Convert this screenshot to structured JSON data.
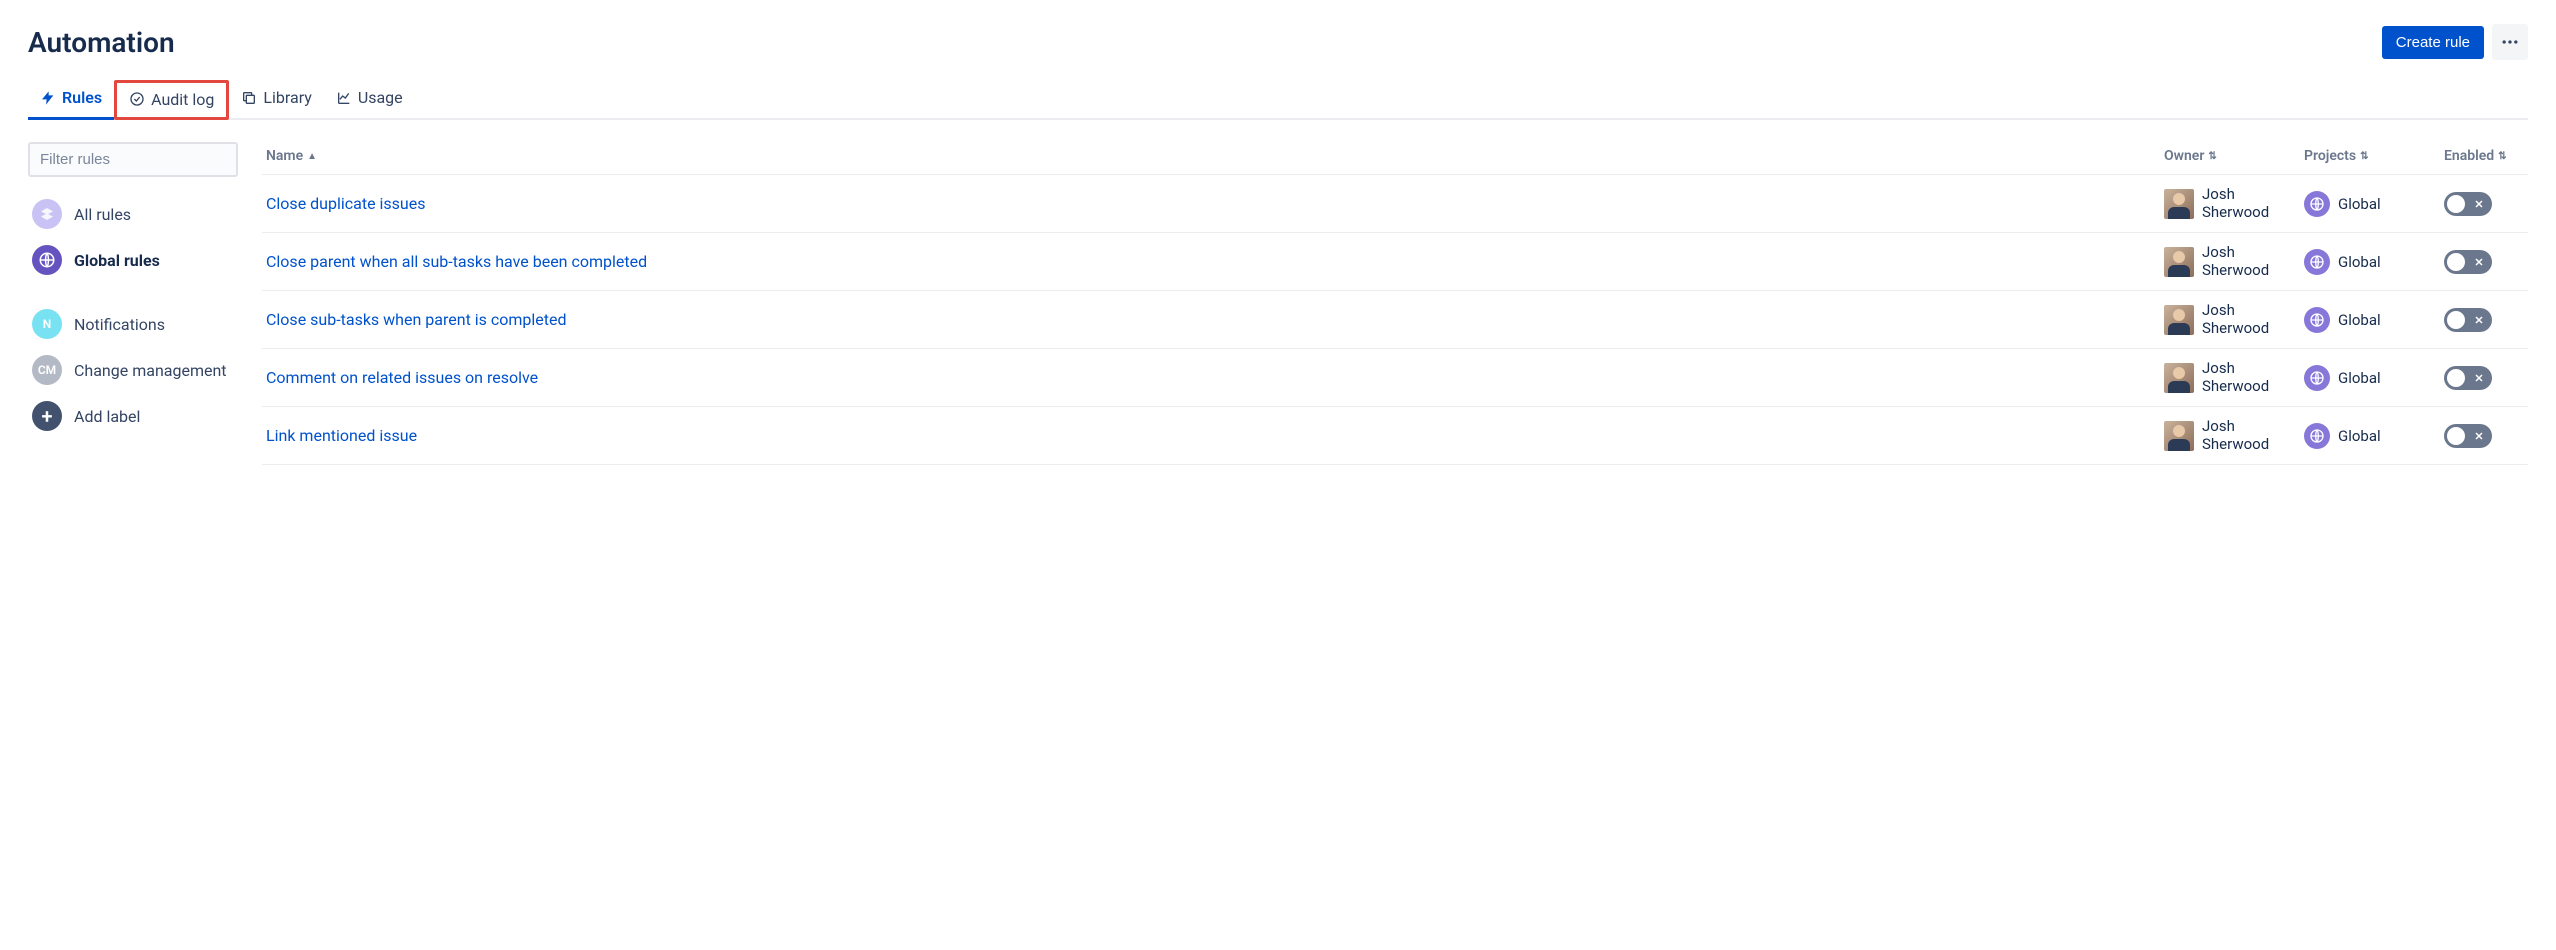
{
  "header": {
    "title": "Automation",
    "create_button": "Create rule"
  },
  "tabs": [
    {
      "id": "rules",
      "label": "Rules",
      "icon": "bolt-icon",
      "active": true
    },
    {
      "id": "auditlog",
      "label": "Audit log",
      "icon": "check-circle-icon",
      "highlighted": true
    },
    {
      "id": "library",
      "label": "Library",
      "icon": "copy-icon"
    },
    {
      "id": "usage",
      "label": "Usage",
      "icon": "chart-icon"
    }
  ],
  "sidebar": {
    "filter_placeholder": "Filter rules",
    "groups": [
      [
        {
          "id": "all",
          "label": "All rules",
          "icon": "all-rules-icon"
        },
        {
          "id": "global",
          "label": "Global rules",
          "icon": "globe-icon",
          "active": true
        }
      ],
      [
        {
          "id": "notifications",
          "label": "Notifications",
          "icon": "letter-n-icon",
          "badge": "N",
          "color": "#79E2F2"
        },
        {
          "id": "changemgmt",
          "label": "Change management",
          "icon": "letters-cm-icon",
          "badge": "CM",
          "color": "#B3BAC5"
        },
        {
          "id": "addlabel",
          "label": "Add label",
          "icon": "plus-icon"
        }
      ]
    ]
  },
  "table": {
    "columns": {
      "name": "Name",
      "owner": "Owner",
      "projects": "Projects",
      "enabled": "Enabled"
    },
    "sorted_by": "name",
    "sort_dir": "asc",
    "rows": [
      {
        "name": "Close duplicate issues",
        "owner": "Josh Sherwood",
        "project": "Global",
        "enabled": false
      },
      {
        "name": "Close parent when all sub-tasks have been completed",
        "owner": "Josh Sherwood",
        "project": "Global",
        "enabled": false
      },
      {
        "name": "Close sub-tasks when parent is completed",
        "owner": "Josh Sherwood",
        "project": "Global",
        "enabled": false
      },
      {
        "name": "Comment on related issues on resolve",
        "owner": "Josh Sherwood",
        "project": "Global",
        "enabled": false
      },
      {
        "name": "Link mentioned issue",
        "owner": "Josh Sherwood",
        "project": "Global",
        "enabled": false
      }
    ]
  }
}
